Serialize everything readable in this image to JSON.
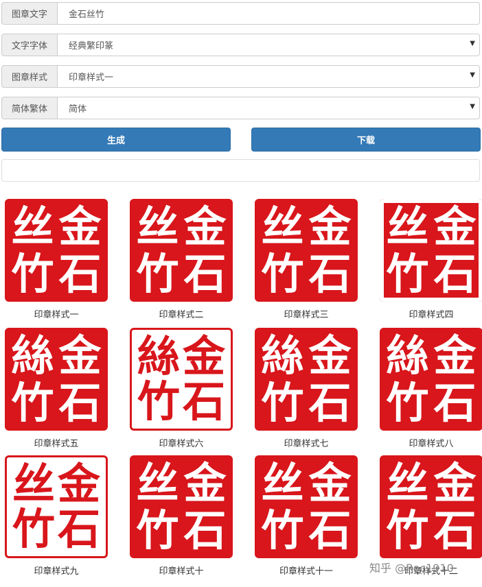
{
  "form": {
    "seal_text": {
      "label": "图章文字",
      "value": "金石丝竹"
    },
    "font": {
      "label": "文字字体",
      "value": "经典繁印篆"
    },
    "style": {
      "label": "图章样式",
      "value": "印章样式一"
    },
    "script": {
      "label": "简体繁体",
      "value": "简体"
    }
  },
  "buttons": {
    "generate": "生成",
    "download": "下载"
  },
  "seals": [
    {
      "caption": "印章样式一",
      "chars": [
        "金",
        "丝",
        "石",
        "竹"
      ]
    },
    {
      "caption": "印章样式二",
      "chars": [
        "金",
        "丝",
        "石",
        "竹"
      ]
    },
    {
      "caption": "印章样式三",
      "chars": [
        "金",
        "丝",
        "石",
        "竹"
      ]
    },
    {
      "caption": "印章样式四",
      "chars": [
        "金",
        "丝",
        "石",
        "竹"
      ]
    },
    {
      "caption": "印章样式五",
      "chars": [
        "金",
        "絲",
        "石",
        "竹"
      ]
    },
    {
      "caption": "印章样式六",
      "chars": [
        "金",
        "絲",
        "石",
        "竹"
      ]
    },
    {
      "caption": "印章样式七",
      "chars": [
        "金",
        "絲",
        "石",
        "竹"
      ]
    },
    {
      "caption": "印章样式八",
      "chars": [
        "金",
        "絲",
        "石",
        "竹"
      ]
    },
    {
      "caption": "印章样式九",
      "chars": [
        "金",
        "丝",
        "石",
        "竹"
      ]
    },
    {
      "caption": "印章样式十",
      "chars": [
        "金",
        "丝",
        "石",
        "竹"
      ]
    },
    {
      "caption": "印章样式十一",
      "chars": [
        "金",
        "丝",
        "石",
        "竹"
      ]
    },
    {
      "caption": "印章样式十二",
      "chars": [
        "金",
        "丝",
        "石",
        "竹"
      ]
    }
  ],
  "watermark": "知乎 @Roc1910",
  "colors": {
    "seal_red": "#d8161b",
    "button_blue": "#337ab7"
  }
}
